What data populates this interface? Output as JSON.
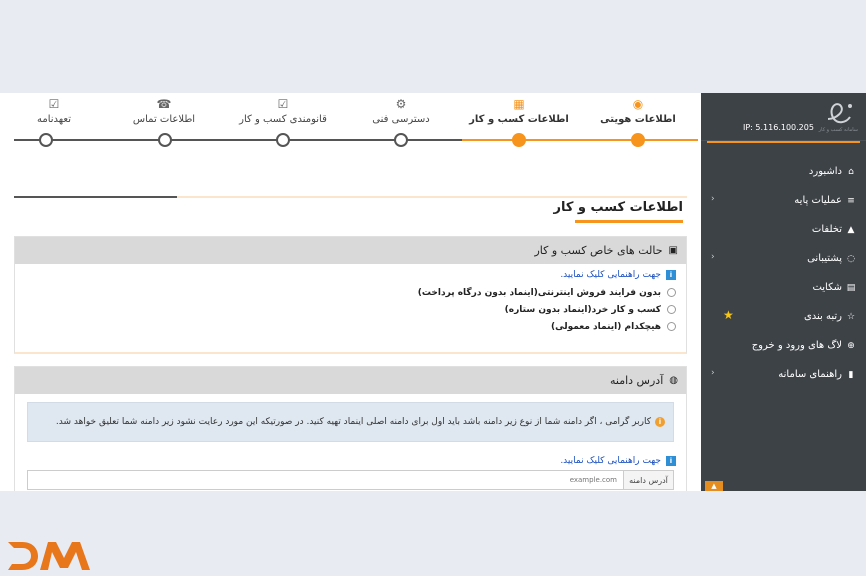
{
  "sidebar": {
    "ip": "IP: 5.116.100.205",
    "logo_caption": "سامانه کسب و کار",
    "items": [
      {
        "label": "داشبورد",
        "icon": "home-icon",
        "glyph": "⌂",
        "chev": ""
      },
      {
        "label": "عملیات پایه",
        "icon": "menu-icon",
        "glyph": "≡",
        "chev": "‹"
      },
      {
        "label": "تخلفات",
        "icon": "warning-icon",
        "glyph": "▲",
        "chev": ""
      },
      {
        "label": "پشتیبانی",
        "icon": "chat-icon",
        "glyph": "◌",
        "chev": "‹"
      },
      {
        "label": "شکایت",
        "icon": "document-icon",
        "glyph": "▤",
        "chev": ""
      },
      {
        "label": "رتبه بندی",
        "icon": "star-outline-icon",
        "glyph": "☆",
        "chev": ""
      },
      {
        "label": "لاگ های ورود و خروج",
        "icon": "plus-circle-icon",
        "glyph": "⊕",
        "chev": ""
      },
      {
        "label": "راهنمای سامانه",
        "icon": "file-icon",
        "glyph": "▮",
        "chev": "‹"
      }
    ]
  },
  "stepper": {
    "steps": [
      {
        "label": "اطلاعات هویتی",
        "glyph": "◉"
      },
      {
        "label": "اطلاعات کسب و کار",
        "glyph": "▦"
      },
      {
        "label": "دسترسی فنی",
        "glyph": "⚙"
      },
      {
        "label": "قانومندی کسب و کار",
        "glyph": "☑"
      },
      {
        "label": "اطلاعات تماس",
        "glyph": "☎"
      },
      {
        "label": "تعهدنامه",
        "glyph": "☑"
      }
    ]
  },
  "main": {
    "title": "اطلاعات کسب و کار",
    "panel1": {
      "title": "حالت های خاص کسب و کار",
      "help": "جهت راهنمایی کلیک نمایید.",
      "options": [
        "بدون فرایند فروش اینترنتی(اینماد بدون درگاه پرداخت)",
        "کسب و کار خرد(اینماد بدون ستاره)",
        "هیچکدام (اینماد معمولی)"
      ]
    },
    "panel2": {
      "title": "آدرس دامنه",
      "alert": "کاربر گرامی ، اگر دامنه شما از نوع زیر دامنه باشد باید اول برای دامنه اصلی اینماد تهیه کنید. در صورتیکه این مورد رعایت نشود زیر دامنه شما تعلیق خواهد شد.",
      "help": "جهت راهنمایی کلیک نمایید.",
      "field_label": "آدرس دامنه",
      "field_placeholder": "example.com"
    }
  },
  "colors": {
    "accent": "#f7941d",
    "sidebar": "#3d4247",
    "brand_logo": "#e8761a"
  }
}
